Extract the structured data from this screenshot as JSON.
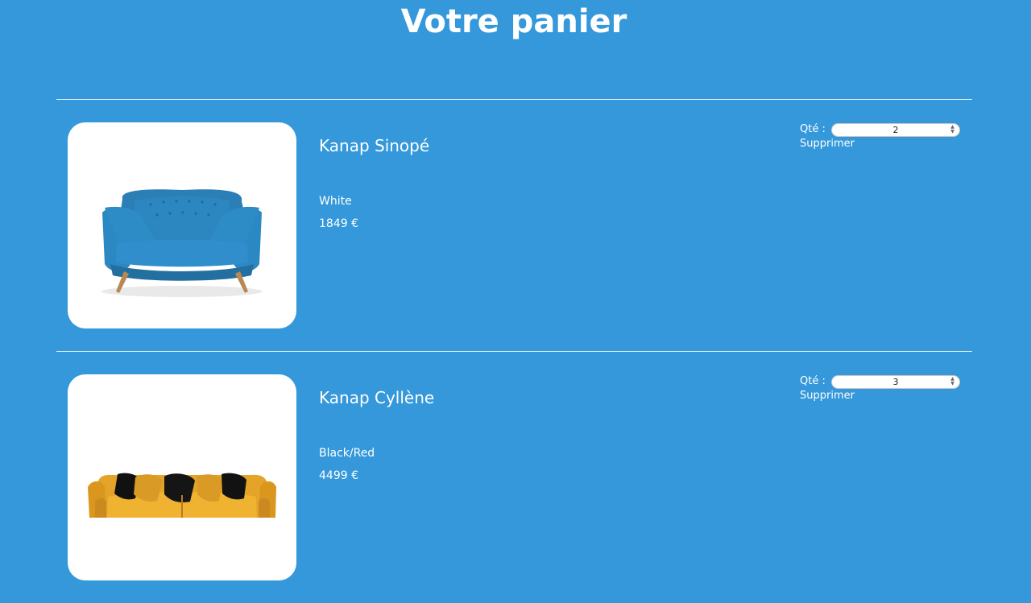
{
  "page": {
    "title": "Votre panier"
  },
  "cart": {
    "quantity_label": "Qté :",
    "delete_label": "Supprimer",
    "items": [
      {
        "name": "Kanap Sinopé",
        "color": "White",
        "price": "1849 €",
        "quantity": "2"
      },
      {
        "name": "Kanap Cyllène",
        "color": "Black/Red",
        "price": "4499 €",
        "quantity": "3"
      }
    ]
  },
  "colors": {
    "background": "#3498DB",
    "text": "#FFFFFF",
    "sofa_blue": "#2F86BE",
    "sofa_yellow": "#E5A72A"
  }
}
